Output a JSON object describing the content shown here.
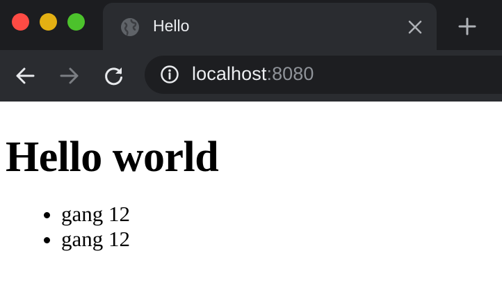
{
  "browser": {
    "tab": {
      "title": "Hello",
      "icon": "globe-icon"
    },
    "address_bar": {
      "host": "localhost",
      "port": ":8080"
    },
    "colors": {
      "close_light": "#fe4b44",
      "minimize_light": "#e3b013",
      "maximize_light": "#4cc22c"
    }
  },
  "page": {
    "heading": "Hello world",
    "items": [
      "gang 12",
      "gang 12"
    ]
  }
}
